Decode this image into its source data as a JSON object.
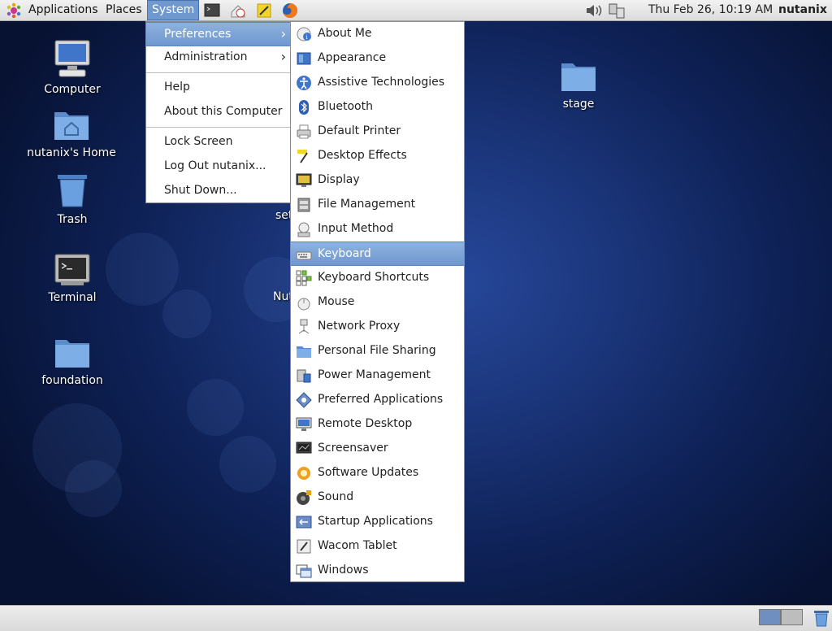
{
  "top_panel": {
    "applications": "Applications",
    "places": "Places",
    "system": "System",
    "clock": "Thu Feb 26, 10:19 AM",
    "username": "nutanix"
  },
  "desktop": {
    "icons": [
      {
        "label": "Computer",
        "icon": "computer-icon"
      },
      {
        "label": "nutanix's Home",
        "icon": "home-folder-icon"
      },
      {
        "label": "Trash",
        "icon": "trash-icon"
      },
      {
        "label": "Terminal",
        "icon": "terminal-icon"
      },
      {
        "label": "foundation",
        "icon": "folder-icon"
      },
      {
        "label": "stage",
        "icon": "folder-icon"
      }
    ],
    "partial_labels": [
      "set",
      "Nut"
    ]
  },
  "system_menu": {
    "items": [
      "Preferences",
      "Administration",
      "Help",
      "About this Computer",
      "Lock Screen",
      "Log Out nutanix...",
      "Shut Down..."
    ],
    "selected": "Preferences"
  },
  "preferences_menu": {
    "items": [
      {
        "label": "About Me",
        "icon": "about-me-icon"
      },
      {
        "label": "Appearance",
        "icon": "appearance-icon"
      },
      {
        "label": "Assistive Technologies",
        "icon": "accessibility-icon"
      },
      {
        "label": "Bluetooth",
        "icon": "bluetooth-icon"
      },
      {
        "label": "Default Printer",
        "icon": "printer-icon"
      },
      {
        "label": "Desktop Effects",
        "icon": "desktop-effects-icon"
      },
      {
        "label": "Display",
        "icon": "display-icon"
      },
      {
        "label": "File Management",
        "icon": "file-management-icon"
      },
      {
        "label": "Input Method",
        "icon": "input-method-icon"
      },
      {
        "label": "Keyboard",
        "icon": "keyboard-icon"
      },
      {
        "label": "Keyboard Shortcuts",
        "icon": "keyboard-shortcuts-icon"
      },
      {
        "label": "Mouse",
        "icon": "mouse-icon"
      },
      {
        "label": "Network Proxy",
        "icon": "network-proxy-icon"
      },
      {
        "label": "Personal File Sharing",
        "icon": "file-sharing-icon"
      },
      {
        "label": "Power Management",
        "icon": "power-management-icon"
      },
      {
        "label": "Preferred Applications",
        "icon": "preferred-apps-icon"
      },
      {
        "label": "Remote Desktop",
        "icon": "remote-desktop-icon"
      },
      {
        "label": "Screensaver",
        "icon": "screensaver-icon"
      },
      {
        "label": "Software Updates",
        "icon": "software-updates-icon"
      },
      {
        "label": "Sound",
        "icon": "sound-icon"
      },
      {
        "label": "Startup Applications",
        "icon": "startup-apps-icon"
      },
      {
        "label": "Wacom Tablet",
        "icon": "wacom-tablet-icon"
      },
      {
        "label": "Windows",
        "icon": "windows-icon"
      }
    ],
    "highlighted": "Keyboard"
  },
  "colors": {
    "selection": "#6f98cf",
    "desktop_center": "#26479a",
    "desktop_edge": "#071233",
    "folder": "#6f9fd8"
  }
}
